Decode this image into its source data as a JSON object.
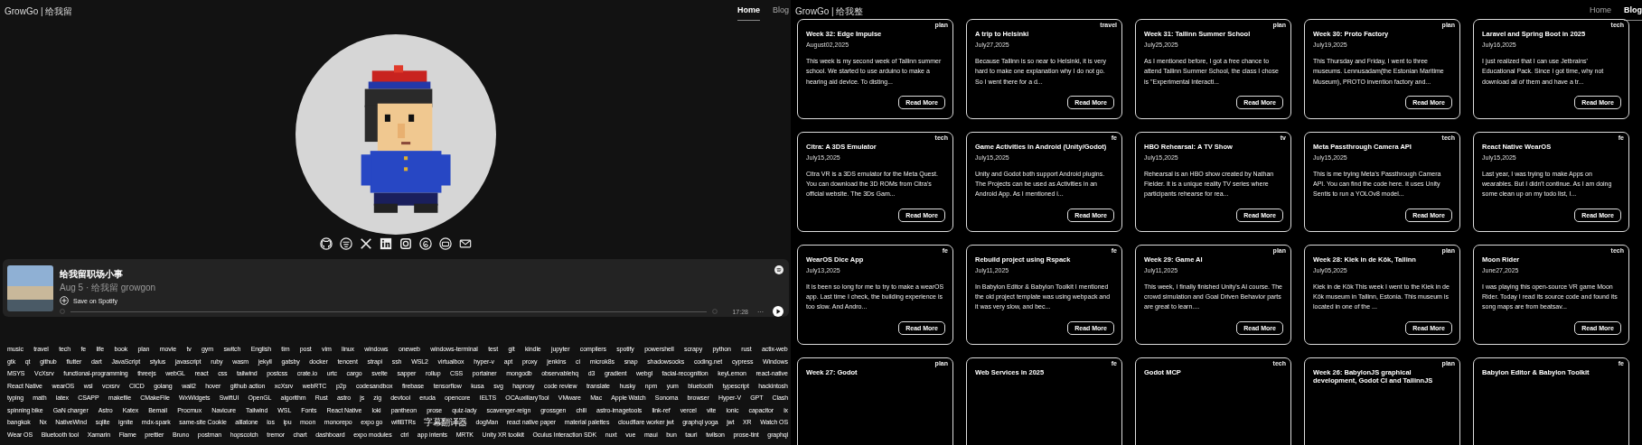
{
  "profile_page": {
    "header": {
      "brand": "GrowGo | 给我留",
      "nav": [
        {
          "label": "Home",
          "selected": true
        },
        {
          "label": "Blog",
          "selected": false
        }
      ]
    },
    "podcast": {
      "title": "给我留职场小事",
      "meta": "Aug 5 · 给我留 growgon",
      "save_label": "Save on Spotify",
      "time": "17:28",
      "more": "···"
    },
    "tag_rows": [
      [
        "music",
        "travel",
        "tech",
        "fe",
        "life",
        "book",
        "plan",
        "movie",
        "tv",
        "gym",
        "switch",
        "English",
        "tim",
        "post",
        "vim",
        "linux",
        "windows",
        "oneweb",
        "windows-terminal",
        "test",
        "git",
        "kindle",
        "jupyter",
        "compilers",
        "spotify",
        "powershell",
        "scrapy",
        "python",
        "rust",
        "actix-web"
      ],
      [
        "gtk",
        "qt",
        "github",
        "flutter",
        "dart",
        "JavaScript",
        "stylus",
        "javascript",
        "ruby",
        "wasm",
        "jekyll",
        "gatsby",
        "docker",
        "tencent",
        "strapi",
        "ssh",
        "WSL2",
        "virtualbox",
        "hyper-v",
        "apt",
        "proxy",
        "jenkins",
        "ci",
        "microk8s",
        "snap",
        "shadowsocks",
        "coding.net",
        "cypress",
        "Windows"
      ],
      [
        "MSYS",
        "VcXsrv",
        "functional-programming",
        "threejs",
        "webGL",
        "react",
        "css",
        "tailwind",
        "postcss",
        "crate.io",
        "urtc",
        "cargo",
        "svelte",
        "sapper",
        "rollup",
        "CSS",
        "portainer",
        "mongodb",
        "observablehq",
        "d3",
        "gradient",
        "webgl",
        "facial-recognition",
        "keyLemon",
        "react-native"
      ],
      [
        "React Native",
        "wearOS",
        "wsl",
        "vcxsrv",
        "CICD",
        "golang",
        "wall2",
        "hover",
        "github action",
        "xcXsrv",
        "webRTC",
        "p2p",
        "codesandbox",
        "firebase",
        "tensorflow",
        "kusa",
        "svg",
        "haproxy",
        "code review",
        "translate",
        "husky",
        "npm",
        "yum",
        "bluetooth",
        "typescript",
        "hackintosh"
      ],
      [
        "typing",
        "math",
        "latex",
        "CSAPP",
        "makefile",
        "CMakeFile",
        "WxWidgets",
        "SwiftUI",
        "OpenGL",
        "algorithm",
        "Rust",
        "astro",
        "js",
        "zig",
        "devtool",
        "eruda",
        "opencore",
        "IELTS",
        "OCAuxiliaryTool",
        "VMware",
        "Mac",
        "Apple Watch",
        "Sonoma",
        "browser",
        "Hyper-V",
        "GPT",
        "Clash"
      ],
      [
        "spinning bike",
        "GaN charger",
        "Astro",
        "Katex",
        "Bemail",
        "Procmux",
        "Navicure",
        "Tailwind",
        "WSL",
        "Fonts",
        "React Native",
        "loki",
        "pantheon",
        "prose",
        "quiz-lady",
        "scavenger-reign",
        "grossgen",
        "chili",
        "astro-imagetools",
        "link-ref",
        "vercel",
        "vite",
        "ionic",
        "capacitor",
        "ix"
      ],
      [
        "bangkok",
        "Nx",
        "NativeWind",
        "sqlite",
        "ignite",
        "mdx-spark",
        "same-site Cookie",
        "alllatone",
        "ios",
        "ipu",
        "moon",
        "monorepo",
        "expo go",
        "wifiBTRs",
        "字幕翻译器",
        "dogMan",
        "react native paper",
        "material palettes",
        "cloudflare worker jwt",
        "graphql yoga",
        "jwt",
        "XR",
        "Watch OS"
      ],
      [
        "Wear OS",
        "Bluetooth tool",
        "Xamarin",
        "Flame",
        "prettier",
        "Bruno",
        "postman",
        "hopscotch",
        "tremor",
        "chart",
        "dashboard",
        "expo modules",
        "ctrl",
        "app intents",
        "MRTK",
        "Unity XR toolkit",
        "Oculus Interaction SDK",
        "nuxt",
        "vue",
        "maui",
        "bun",
        "tauri",
        "twilson",
        "prose-tint",
        "graphql"
      ]
    ]
  },
  "blog_page": {
    "header": {
      "brand": "GrowGo | 给我整",
      "nav": [
        {
          "label": "Home",
          "selected": false
        },
        {
          "label": "Blog",
          "selected": true
        }
      ]
    },
    "posts": [
      {
        "title": "Week 32: Edge Impulse",
        "tag": "plan",
        "date": "August02,2025",
        "excerpt": "This week is my second week of Tallinn summer school. We started to use arduino to make a hearing aid device. To disting...",
        "action": "Read More"
      },
      {
        "title": "A trip to Helsinki",
        "tag": "travel",
        "date": "July27,2025",
        "excerpt": "Because Tallinn is so near to Helsinki, it is very hard to make one explanation why I do not go. So I went there for a d...",
        "action": "Read More"
      },
      {
        "title": "Week 31: Tallinn Summer School",
        "tag": "plan",
        "date": "July25,2025",
        "excerpt": "As I mentioned before, I got a free chance to attend Tallinn Summer School, the class I chose is \"Experimental Interacti...",
        "action": "Read More"
      },
      {
        "title": "Week 30: Proto Factory",
        "tag": "plan",
        "date": "July19,2025",
        "excerpt": "This Thursday and Friday, I went to three museums. Lennusadam(the Estonian Maritime Museum), PROTO invention factory and...",
        "action": "Read More"
      },
      {
        "title": "Laravel and Spring Boot in 2025",
        "tag": "tech",
        "date": "July16,2025",
        "excerpt": "I just realized that I can use Jetbrains' Educational Pack. Since I got time, why not download all of them and have a tr...",
        "action": "Read More"
      },
      {
        "title": "Citra: A 3DS Emulator",
        "tag": "tech",
        "date": "July15,2025",
        "excerpt": "Citra VR is a 3DS emulator for the Meta Quest. You can download the 3D ROMs from Citra's official website. The 3Ds Gam...",
        "action": "Read More"
      },
      {
        "title": "Game Activities in Android (Unity/Godot)",
        "tag": "fe",
        "date": "July15,2025",
        "excerpt": "Unity and Godot both support Android plugins. The Projects can be used as Activities in an Android App. As I mentioned i...",
        "action": "Read More"
      },
      {
        "title": "HBO Rehearsal: A TV Show",
        "tag": "tv",
        "date": "July15,2025",
        "excerpt": "Rehearsal is an HBO show created by Nathan Fielder. It is a unique reality TV series where participants rehearse for rea...",
        "action": "Read More"
      },
      {
        "title": "Meta Passthrough Camera API",
        "tag": "tech",
        "date": "July15,2025",
        "excerpt": "This is me trying Meta's Passthrough Camera API. You can find the code here. It uses Unity Sentis to run a YOLOv8 model...",
        "action": "Read More"
      },
      {
        "title": "React Native WearOS",
        "tag": "fe",
        "date": "July15,2025",
        "excerpt": "Last year, I was trying to make Apps on wearables. But I didn't continue. As I am doing some clean up on my todo list, I...",
        "action": "Read More"
      },
      {
        "title": "WearOS Dice App",
        "tag": "fe",
        "date": "July13,2025",
        "excerpt": "It is been so long for me to try to make a wearOS app. Last time I check, the building experience is too slow. And Andro...",
        "action": "Read More"
      },
      {
        "title": "Rebuild project using Rspack",
        "tag": "fe",
        "date": "July11,2025",
        "excerpt": "In Babylon Editor & Babylon Toolkit I mentioned the old project template was using webpack and it was very slow, and bec...",
        "action": "Read More"
      },
      {
        "title": "Week 29: Game AI",
        "tag": "plan",
        "date": "July11,2025",
        "excerpt": "This week, I finally finished Unity's AI course. The crowd simulation and Goal Driven Behavior parts are great to learn....",
        "action": "Read More"
      },
      {
        "title": "Week 28: Kiek in de Kök, Tallinn",
        "tag": "plan",
        "date": "July05,2025",
        "excerpt": "Kiek in de Kök This week I went to the Kiek in de Kök museum in Tallinn, Estonia. This museum is located in one of the ...",
        "action": "Read More"
      },
      {
        "title": "Moon Rider",
        "tag": "tech",
        "date": "June27,2025",
        "excerpt": "I was playing this open-source VR game Moon Rider. Today I read its source code and found its song maps are from beatsav...",
        "action": "Read More"
      },
      {
        "title": "Week 27: Godot",
        "tag": "plan"
      },
      {
        "title": "Web Services in 2025",
        "tag": "fe"
      },
      {
        "title": "Godot MCP",
        "tag": "tech"
      },
      {
        "title": "Week 26: BabylonJS graphical development, Godot CI and TallinnJS",
        "tag": "plan"
      },
      {
        "title": "Babylon Editor & Babylon Toolkit",
        "tag": "fe"
      }
    ]
  }
}
